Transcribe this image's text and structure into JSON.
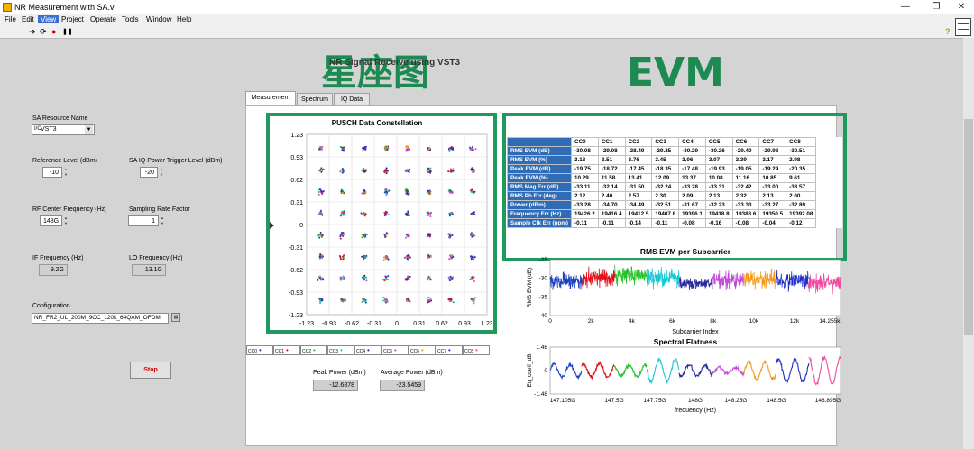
{
  "window": {
    "title": "NR Measurement with SA.vi"
  },
  "menu": [
    "File",
    "Edit",
    "View",
    "Project",
    "Operate",
    "Tools",
    "Window",
    "Help"
  ],
  "toolbar": {
    "run": "➔",
    "run_cont": "⟳",
    "abort": "●",
    "pause": "❚❚",
    "help": "?"
  },
  "header": {
    "vi_title": "NR Signal Receive using VST3"
  },
  "overlay": {
    "constellation_cn": "星座图",
    "evm": "EVM"
  },
  "tabs": [
    "Measurement",
    "Spectrum",
    "IQ Data"
  ],
  "controls": {
    "resource_label": "SA Resource Name",
    "resource_value": "VST3",
    "ref_level_label": "Reference Level (dBm)",
    "ref_level_value": "-10",
    "trigger_label": "SA IQ Power Trigger Level (dBm)",
    "trigger_value": "-20",
    "center_freq_label": "RF Center Frequency (Hz)",
    "center_freq_value": "148G",
    "sampling_label": "Sampling Rate Factor",
    "sampling_value": "1",
    "if_label": "IF Frequency (Hz)",
    "if_value": "9.2G",
    "lo_label": "LO Frequency (Hz)",
    "lo_value": "13.1G",
    "config_label": "Configuration",
    "config_value": "NR_FR2_UL_200M_9CC_120k_64QAM_OFDM",
    "stop_label": "Stop"
  },
  "power": {
    "peak_label": "Peak Power (dBm)",
    "peak_value": "-12.6878",
    "avg_label": "Average Power (dBm)",
    "avg_value": "-23.5459"
  },
  "legend": [
    "CC0",
    "CC1",
    "CC2",
    "CC3",
    "CC4",
    "CC5",
    "CC6",
    "CC7",
    "CC8"
  ],
  "colors": {
    "accent_green": "#1f9a5c",
    "table_header": "#2f6cb5",
    "stop_text": "#cc0000",
    "cc": [
      "#1f3fbf",
      "#e0101a",
      "#27c22b",
      "#19c6d6",
      "#2a2a9a",
      "#c24ed6",
      "#f39a16",
      "#2030c8",
      "#f04aa0"
    ]
  },
  "constellation_chart": {
    "title": "PUSCH Data Constellation",
    "y_ticks": [
      "1.23",
      "0.93",
      "0.62",
      "0.31",
      "0",
      "-0.31",
      "-0.62",
      "-0.93",
      "-1.23"
    ],
    "x_ticks": [
      "-1.23",
      "-0.93",
      "-0.62",
      "-0.31",
      "0",
      "0.31",
      "0.62",
      "0.93",
      "1.23"
    ]
  },
  "evm_table": {
    "columns": [
      "CC0",
      "CC1",
      "CC2",
      "CC3",
      "CC4",
      "CC5",
      "CC6",
      "CC7",
      "CC8"
    ],
    "rows": [
      {
        "label": "RMS EVM (dB)",
        "values": [
          "-30.08",
          "-29.08",
          "-28.49",
          "-29.25",
          "-30.29",
          "-30.26",
          "-29.40",
          "-29.98",
          "-30.51"
        ]
      },
      {
        "label": "RMS EVM (%)",
        "values": [
          "3.13",
          "3.51",
          "3.76",
          "3.45",
          "3.06",
          "3.07",
          "3.39",
          "3.17",
          "2.98"
        ]
      },
      {
        "label": "Peak EVM (dB)",
        "values": [
          "-19.75",
          "-18.72",
          "-17.45",
          "-18.35",
          "-17.48",
          "-19.93",
          "-19.05",
          "-19.29",
          "-20.35"
        ]
      },
      {
        "label": "Peak EVM (%)",
        "values": [
          "10.29",
          "11.58",
          "13.41",
          "12.09",
          "13.37",
          "10.08",
          "11.16",
          "10.85",
          "9.61"
        ]
      },
      {
        "label": "RMS Mag Err (dB)",
        "values": [
          "-33.11",
          "-32.14",
          "-31.50",
          "-32.24",
          "-33.28",
          "-33.31",
          "-32.42",
          "-33.00",
          "-33.57"
        ]
      },
      {
        "label": "RMS Ph Err (deg)",
        "values": [
          "2.12",
          "2.40",
          "2.57",
          "2.30",
          "2.09",
          "2.13",
          "2.32",
          "2.13",
          "2.00"
        ]
      },
      {
        "label": "Power (dBm)",
        "values": [
          "-33.28",
          "-34.70",
          "-34.49",
          "-32.51",
          "-31.67",
          "-32.23",
          "-33.33",
          "-33.27",
          "-32.89"
        ]
      },
      {
        "label": "Frequency Err (Hz)",
        "values": [
          "19426.2",
          "19416.4",
          "19412.5",
          "19407.8",
          "19396.1",
          "19418.8",
          "19388.6",
          "19350.5",
          "19392.08"
        ]
      },
      {
        "label": "Sample Clk Err (ppm)",
        "values": [
          "-0.11",
          "-0.11",
          "-0.14",
          "-0.11",
          "-0.08",
          "-0.16",
          "-0.08",
          "-0.04",
          "-0.12"
        ]
      }
    ]
  },
  "chart_data": [
    {
      "type": "line",
      "title": "RMS EVM per Subcarrier",
      "xlabel": "Subcarrier Index",
      "ylabel": "RMS EVM (dB)",
      "xlim": [
        0,
        14255
      ],
      "ylim": [
        -40,
        -25
      ],
      "x_ticks": [
        "0",
        "2k",
        "4k",
        "6k",
        "8k",
        "10k",
        "12k",
        "14.255k"
      ],
      "y_ticks": [
        "-25",
        "-30",
        "-35",
        "-40"
      ],
      "series": [
        {
          "x_range": [
            0,
            1584
          ],
          "mean": -31.0,
          "spread": 3.5
        },
        {
          "x_range": [
            1584,
            3168
          ],
          "mean": -30.0,
          "spread": 3.5
        },
        {
          "x_range": [
            3168,
            4752
          ],
          "mean": -29.0,
          "spread": 3.5
        },
        {
          "x_range": [
            4752,
            6336
          ],
          "mean": -30.0,
          "spread": 3.5
        },
        {
          "x_range": [
            6336,
            7920
          ],
          "mean": -31.5,
          "spread": 2.5
        },
        {
          "x_range": [
            7920,
            9504
          ],
          "mean": -30.5,
          "spread": 3.5
        },
        {
          "x_range": [
            9504,
            11088
          ],
          "mean": -30.0,
          "spread": 3.5
        },
        {
          "x_range": [
            11088,
            12672
          ],
          "mean": -30.5,
          "spread": 3.5
        },
        {
          "x_range": [
            12672,
            14255
          ],
          "mean": -31.0,
          "spread": 3.5
        }
      ]
    },
    {
      "type": "line",
      "title": "Spectral Flatness",
      "xlabel": "frequency (Hz)",
      "ylabel": "Eq_coeff_dB",
      "xlim": [
        147.105,
        148.895
      ],
      "ylim": [
        -1.48,
        1.48
      ],
      "x_ticks": [
        "147.105G",
        "147.5G",
        "147.75G",
        "148G",
        "148.25G",
        "148.5G",
        "148.895G"
      ],
      "y_ticks": [
        "1.48",
        "0",
        "-1.48"
      ],
      "series": [
        {
          "x_range": [
            147.105,
            147.3
          ],
          "amp": 0.6
        },
        {
          "x_range": [
            147.3,
            147.5
          ],
          "amp": 0.6
        },
        {
          "x_range": [
            147.5,
            147.7
          ],
          "amp": 0.5
        },
        {
          "x_range": [
            147.7,
            147.9
          ],
          "amp": 1.0
        },
        {
          "x_range": [
            147.9,
            148.1
          ],
          "amp": 0.5
        },
        {
          "x_range": [
            148.1,
            148.3
          ],
          "amp": 0.3
        },
        {
          "x_range": [
            148.3,
            148.5
          ],
          "amp": 0.8
        },
        {
          "x_range": [
            148.5,
            148.7
          ],
          "amp": 1.0
        },
        {
          "x_range": [
            148.7,
            148.895
          ],
          "amp": 1.2
        }
      ]
    }
  ]
}
